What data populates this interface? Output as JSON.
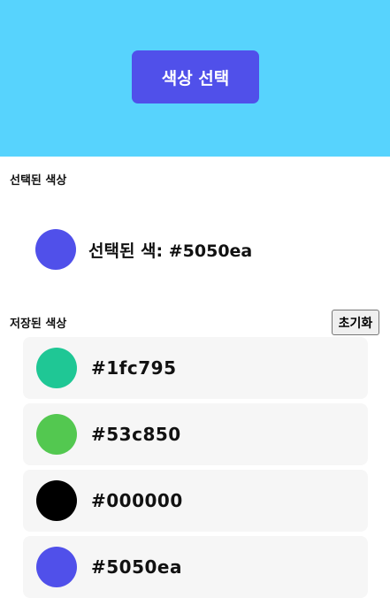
{
  "header": {
    "button_label": "색상 선택",
    "background_color": "#57d3fd",
    "button_color": "#5050ea"
  },
  "selected": {
    "section_title": "선택된 색상",
    "label": "선택된 색: #5050ea",
    "color": "#5050ea"
  },
  "saved": {
    "section_title": "저장된 색상",
    "reset_label": "초기화",
    "items": [
      {
        "hex": "#1fc795",
        "color": "#1fc795"
      },
      {
        "hex": "#53c850",
        "color": "#53c850"
      },
      {
        "hex": "#000000",
        "color": "#000000"
      },
      {
        "hex": "#5050ea",
        "color": "#5050ea"
      }
    ]
  }
}
